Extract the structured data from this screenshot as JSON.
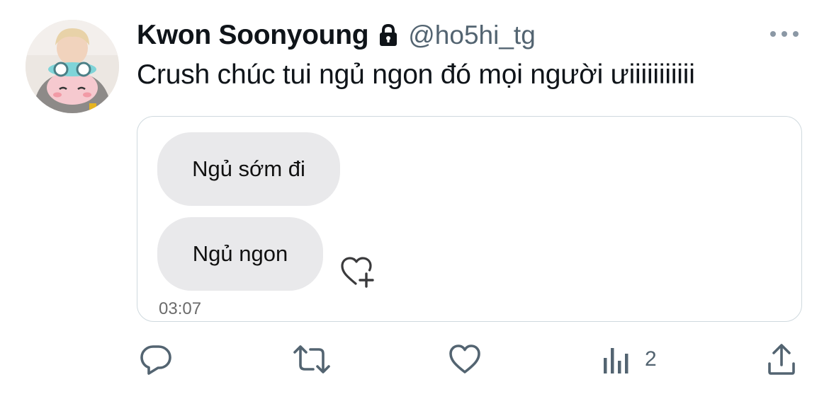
{
  "tweet": {
    "author": {
      "display_name": "Kwon Soonyoung",
      "handle": "@ho5hi_tg",
      "protected_icon": "lock-icon"
    },
    "text": "Crush chúc tui ngủ ngon đó mọi người ưiiiiiiiiiii",
    "media": {
      "messages": [
        {
          "text": "Ngủ sớm đi"
        },
        {
          "text": "Ngủ ngon"
        }
      ],
      "timestamp": "03:07",
      "reaction_icon": "heart-plus-icon"
    },
    "actions": {
      "reply_icon": "reply-icon",
      "retweet_icon": "retweet-icon",
      "like_icon": "heart-icon",
      "views_icon": "views-chart-icon",
      "views_count": "2",
      "share_icon": "share-icon"
    },
    "colors": {
      "text_primary": "#0f1419",
      "text_secondary": "#536471",
      "card_border": "#cfd9de",
      "bubble_bg": "#e9e9eb"
    }
  }
}
